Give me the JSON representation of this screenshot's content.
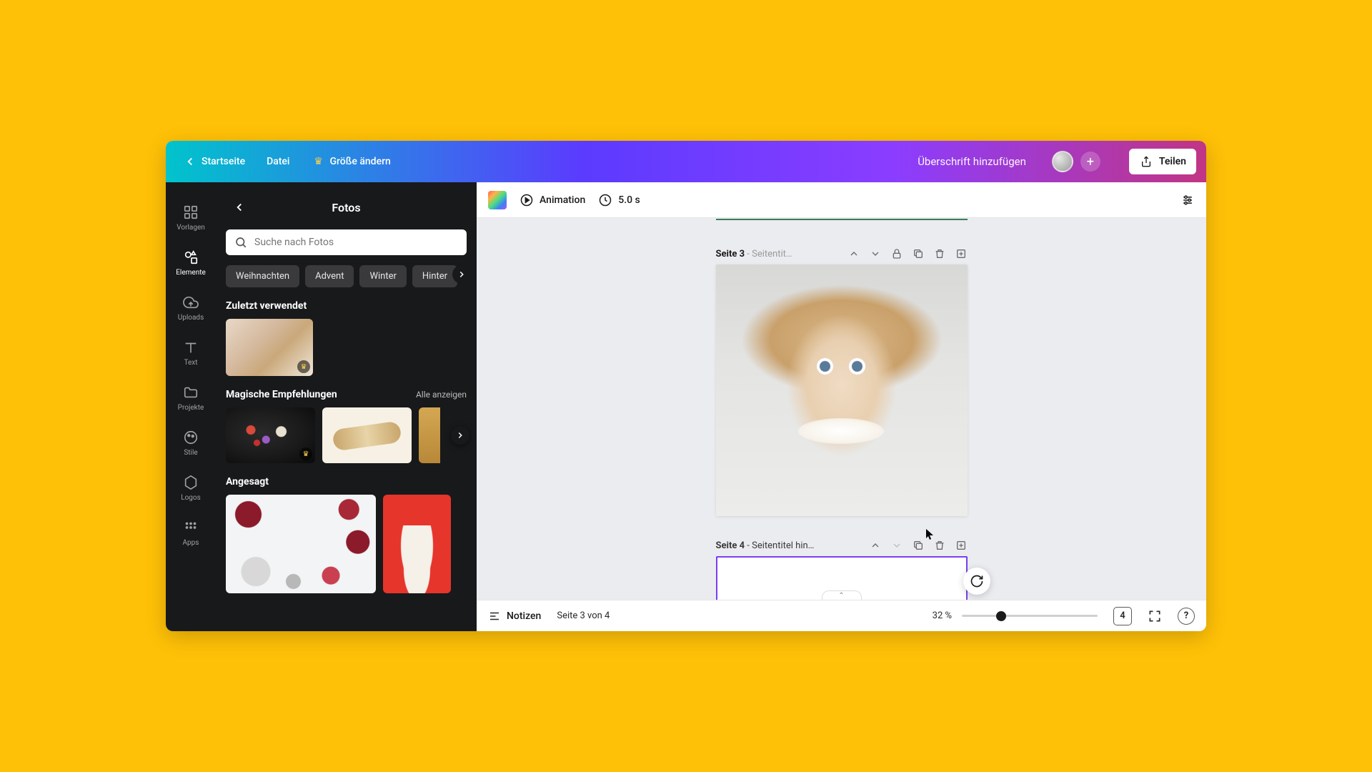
{
  "topbar": {
    "home": "Startseite",
    "file": "Datei",
    "resize": "Größe ändern",
    "doc_title": "Überschrift hinzufügen",
    "share": "Teilen"
  },
  "rail": {
    "templates": "Vorlagen",
    "elements": "Elemente",
    "uploads": "Uploads",
    "text": "Text",
    "projects": "Projekte",
    "styles": "Stile",
    "logos": "Logos",
    "apps": "Apps"
  },
  "panel": {
    "title": "Fotos",
    "search_placeholder": "Suche nach Fotos",
    "chips": [
      "Weihnachten",
      "Advent",
      "Winter",
      "Hinter"
    ],
    "recent_title": "Zuletzt verwendet",
    "magic_title": "Magische Empfehlungen",
    "see_all": "Alle anzeigen",
    "trending_title": "Angesagt"
  },
  "context": {
    "animation": "Animation",
    "duration": "5.0 s"
  },
  "pages": {
    "p3_label_prefix": "Seite 3",
    "p3_label_suffix": " - Seitentit…",
    "p4_label_prefix": "Seite 4",
    "p4_label_suffix": " - Seitentitel hin…"
  },
  "footer": {
    "notes": "Notizen",
    "page_of": "Seite 3 von 4",
    "zoom": "32 %",
    "total_pages": "4"
  }
}
